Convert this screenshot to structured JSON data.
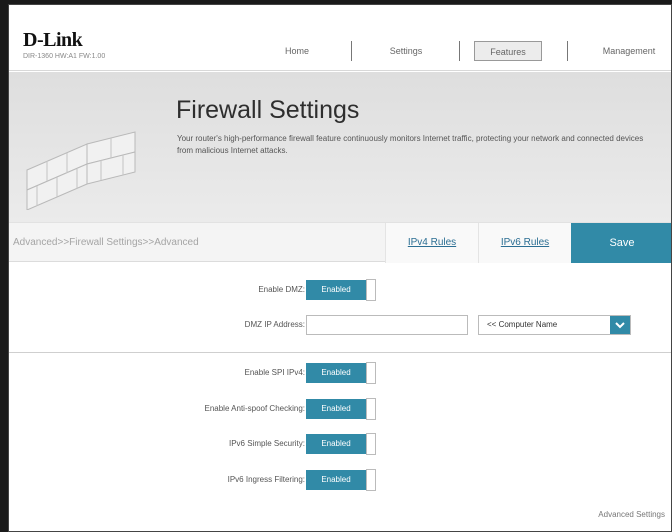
{
  "brand": {
    "logo": "D-Link",
    "model": "DIR-1360 HW:A1 FW:1.00"
  },
  "nav": {
    "items": [
      "Home",
      "Settings",
      "Features",
      "Management"
    ],
    "active": "Features"
  },
  "banner": {
    "title": "Firewall Settings",
    "description": "Your router's high-performance firewall feature continuously monitors Internet traffic, protecting your network and connected devices from malicious Internet attacks."
  },
  "actionbar": {
    "breadcrumb": "Advanced>>Firewall Settings>>Advanced",
    "ipv4_label": "IPv4 Rules",
    "ipv6_label": "IPv6 Rules",
    "save_label": "Save"
  },
  "form": {
    "dmz": {
      "label": "Enable DMZ:",
      "state": "Enabled"
    },
    "dmz_ip": {
      "label": "DMZ IP Address:",
      "value": "",
      "select": "<< Computer Name"
    },
    "spi_ipv4": {
      "label": "Enable SPI IPv4:",
      "state": "Enabled"
    },
    "anti_spoof": {
      "label": "Enable Anti-spoof Checking:",
      "state": "Enabled"
    },
    "ipv6_simple": {
      "label": "IPv6 Simple Security:",
      "state": "Enabled"
    },
    "ipv6_ingress": {
      "label": "IPv6 Ingress Filtering:",
      "state": "Enabled"
    }
  },
  "footer": {
    "advanced_settings": "Advanced Settings"
  },
  "colors": {
    "accent": "#318aa7",
    "link": "#2b6e93"
  }
}
